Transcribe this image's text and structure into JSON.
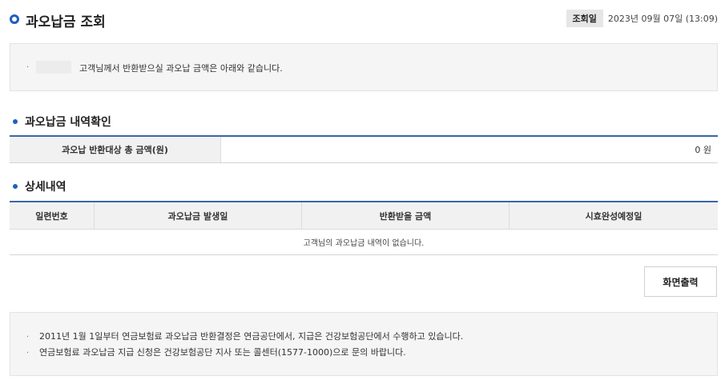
{
  "header": {
    "title": "과오납금 조회",
    "query_date_label": "조회일",
    "query_date_value": "2023년 09월 07일 (13:09)"
  },
  "info": {
    "bullet": "·",
    "message": "고객님께서 반환받으실 과오납 금액은 아래와 같습니다."
  },
  "summary": {
    "section_title": "과오납금 내역확인",
    "label": "과오납 반환대상 총 금액(원)",
    "value": "0 원"
  },
  "detail": {
    "section_title": "상세내역",
    "columns": [
      "일련번호",
      "과오납금 발생일",
      "반환받을 금액",
      "시효완성예정일"
    ],
    "empty_message": "고객님의 과오납금 내역이 없습니다."
  },
  "actions": {
    "print_label": "화면출력"
  },
  "notice": {
    "items": [
      "2011년 1월 1일부터 연금보험료 과오납금 반환결정은 연금공단에서, 지급은 건강보험공단에서 수행하고 있습니다.",
      "연금보험료 과오납금 지급 신청은 건강보험공단 지사 또는 콜센터(1577-1000)으로 문의 바랍니다."
    ]
  },
  "colors": {
    "accent": "#1f5fbf",
    "table_top_border": "#3a66a8",
    "box_bg": "#f5f5f5"
  }
}
